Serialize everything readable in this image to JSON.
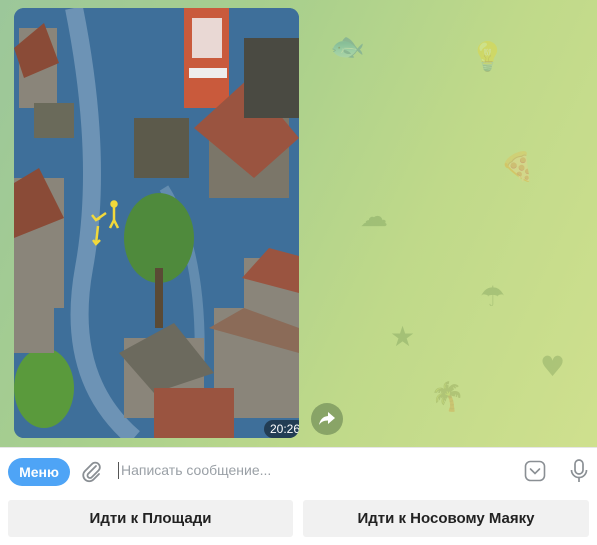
{
  "message": {
    "time": "20:26"
  },
  "composer": {
    "menu_label": "Меню",
    "placeholder": "Написать сообщение..."
  },
  "keyboard": {
    "buttons": [
      {
        "label": "Идти к Площади"
      },
      {
        "label": "Идти к Носовому Маяку"
      }
    ]
  },
  "icons": {
    "attach": "paperclip-icon",
    "emoji": "emoji-icon",
    "mic": "microphone-icon",
    "share": "share-arrow-icon"
  },
  "colors": {
    "accent": "#4ea4f6",
    "chat_bg": "#b8d58c"
  }
}
